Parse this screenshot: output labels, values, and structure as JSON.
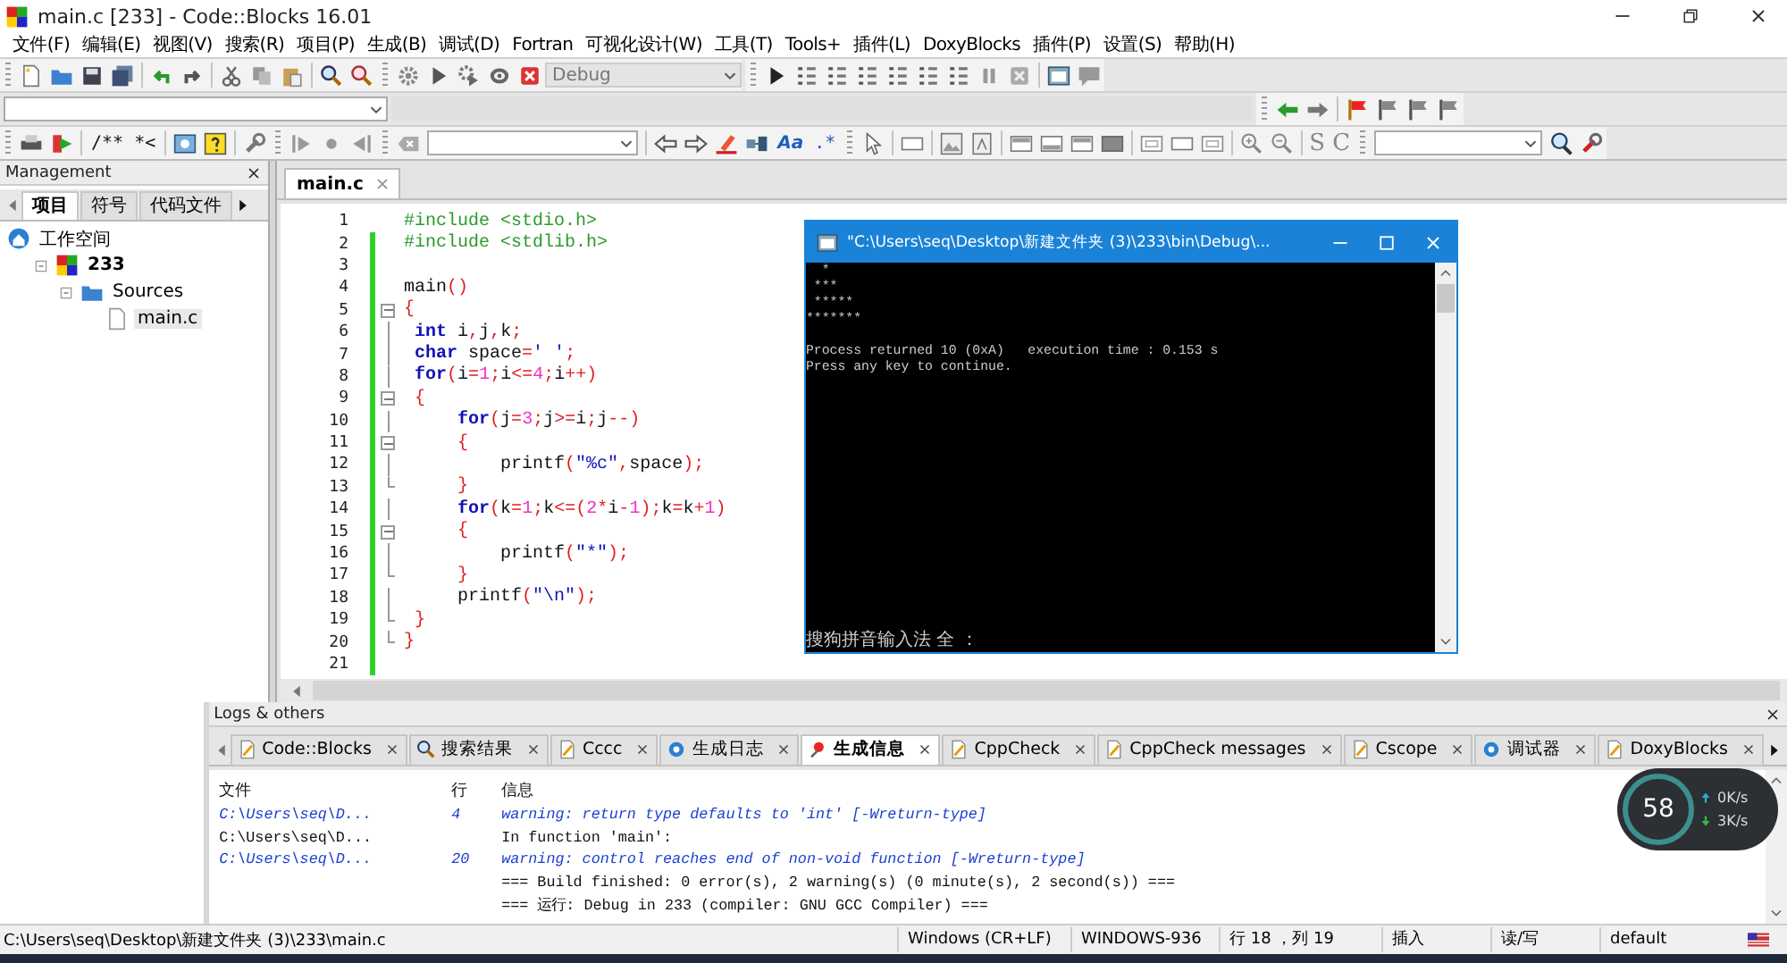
{
  "window": {
    "title": "main.c [233] - Code::Blocks 16.01"
  },
  "menu": [
    "文件(F)",
    "编辑(E)",
    "视图(V)",
    "搜索(R)",
    "项目(P)",
    "生成(B)",
    "调试(D)",
    "Fortran",
    "可视化设计(W)",
    "工具(T)",
    "Tools+",
    "插件(L)",
    "DoxyBlocks",
    "插件(P)",
    "设置(S)",
    "帮助(H)"
  ],
  "toolbar": {
    "build_target": "Debug",
    "doc_comment": "/**",
    "line_comment": "*<",
    "match_case": "Aa",
    "regex": ".*",
    "s_button": "S",
    "c_button": "C"
  },
  "management": {
    "title": "Management",
    "tabs": [
      {
        "label": "项目",
        "selected": true
      },
      {
        "label": "符号",
        "selected": false
      },
      {
        "label": "代码文件",
        "selected": false
      }
    ],
    "tree": [
      {
        "label": "工作空间",
        "kind": "workspace",
        "selected": false,
        "children": [
          {
            "label": "233",
            "kind": "project",
            "selected": false,
            "expanded": true,
            "children": [
              {
                "label": "Sources",
                "kind": "folder",
                "selected": false,
                "expanded": true,
                "children": [
                  {
                    "label": "main.c",
                    "kind": "file",
                    "selected": true
                  }
                ]
              }
            ]
          }
        ]
      }
    ]
  },
  "editor": {
    "tabs": [
      {
        "label": "main.c",
        "selected": true
      }
    ],
    "lines": [
      {
        "number": "1",
        "changed": false,
        "tokens": [
          {
            "kind": "pp",
            "text": "#include <stdio.h>"
          }
        ]
      },
      {
        "number": "2",
        "changed": true,
        "tokens": [
          {
            "kind": "pp",
            "text": "#include <stdlib.h>"
          }
        ]
      },
      {
        "number": "3",
        "changed": true
      },
      {
        "number": "4",
        "changed": true,
        "tokens": [
          {
            "kind": "id",
            "text": "main"
          },
          {
            "kind": "op",
            "text": "()"
          }
        ]
      },
      {
        "number": "5",
        "changed": true,
        "kind": "foldstart",
        "tokens": [
          {
            "kind": "op",
            "text": "{"
          }
        ]
      },
      {
        "number": "6",
        "changed": true,
        "kind": "foldbody",
        "tokens": [
          {
            "kind": "kw",
            "text": " int"
          },
          {
            "kind": "id",
            "text": " i"
          },
          {
            "kind": "op",
            "text": ","
          },
          {
            "kind": "id",
            "text": "j"
          },
          {
            "kind": "op",
            "text": ","
          },
          {
            "kind": "id",
            "text": "k"
          },
          {
            "kind": "op",
            "text": ";"
          }
        ]
      },
      {
        "number": "7",
        "changed": true,
        "kind": "foldbody",
        "tokens": [
          {
            "kind": "kw",
            "text": " char"
          },
          {
            "kind": "id",
            "text": " space"
          },
          {
            "kind": "op",
            "text": "="
          },
          {
            "kind": "str",
            "text": "' '"
          },
          {
            "kind": "op",
            "text": ";"
          }
        ]
      },
      {
        "number": "8",
        "changed": true,
        "kind": "foldbody",
        "tokens": [
          {
            "kind": "kw",
            "text": " for"
          },
          {
            "kind": "op",
            "text": "("
          },
          {
            "kind": "id",
            "text": "i"
          },
          {
            "kind": "op",
            "text": "="
          },
          {
            "kind": "num",
            "text": "1"
          },
          {
            "kind": "op",
            "text": ";"
          },
          {
            "kind": "id",
            "text": "i"
          },
          {
            "kind": "op",
            "text": "<="
          },
          {
            "kind": "num",
            "text": "4"
          },
          {
            "kind": "op",
            "text": ";"
          },
          {
            "kind": "id",
            "text": "i"
          },
          {
            "kind": "op",
            "text": "++)"
          }
        ]
      },
      {
        "number": "9",
        "changed": true,
        "kind": "foldstart",
        "tokens": [
          {
            "kind": "op",
            "text": " {"
          }
        ]
      },
      {
        "number": "10",
        "changed": true,
        "kind": "foldbody",
        "tokens": [
          {
            "kind": "kw",
            "text": "     for"
          },
          {
            "kind": "op",
            "text": "("
          },
          {
            "kind": "id",
            "text": "j"
          },
          {
            "kind": "op",
            "text": "="
          },
          {
            "kind": "num",
            "text": "3"
          },
          {
            "kind": "op",
            "text": ";"
          },
          {
            "kind": "id",
            "text": "j"
          },
          {
            "kind": "op",
            "text": ">="
          },
          {
            "kind": "id",
            "text": "i"
          },
          {
            "kind": "op",
            "text": ";"
          },
          {
            "kind": "id",
            "text": "j"
          },
          {
            "kind": "op",
            "text": "--)"
          }
        ]
      },
      {
        "number": "11",
        "changed": true,
        "kind": "foldstart",
        "tokens": [
          {
            "kind": "op",
            "text": "     {"
          }
        ]
      },
      {
        "number": "12",
        "changed": true,
        "kind": "foldbody",
        "tokens": [
          {
            "kind": "id",
            "text": "         printf"
          },
          {
            "kind": "op",
            "text": "("
          },
          {
            "kind": "str",
            "text": "\"%c\""
          },
          {
            "kind": "op",
            "text": ","
          },
          {
            "kind": "id",
            "text": "space"
          },
          {
            "kind": "op",
            "text": ");"
          }
        ]
      },
      {
        "number": "13",
        "changed": true,
        "kind": "foldend",
        "tokens": [
          {
            "kind": "op",
            "text": "     }"
          }
        ]
      },
      {
        "number": "14",
        "changed": true,
        "kind": "foldbody",
        "tokens": [
          {
            "kind": "kw",
            "text": "     for"
          },
          {
            "kind": "op",
            "text": "("
          },
          {
            "kind": "id",
            "text": "k"
          },
          {
            "kind": "op",
            "text": "="
          },
          {
            "kind": "num",
            "text": "1"
          },
          {
            "kind": "op",
            "text": ";"
          },
          {
            "kind": "id",
            "text": "k"
          },
          {
            "kind": "op",
            "text": "<=("
          },
          {
            "kind": "num",
            "text": "2"
          },
          {
            "kind": "op",
            "text": "*"
          },
          {
            "kind": "id",
            "text": "i"
          },
          {
            "kind": "op",
            "text": "-"
          },
          {
            "kind": "num",
            "text": "1"
          },
          {
            "kind": "op",
            "text": ");"
          },
          {
            "kind": "id",
            "text": "k"
          },
          {
            "kind": "op",
            "text": "="
          },
          {
            "kind": "id",
            "text": "k"
          },
          {
            "kind": "op",
            "text": "+"
          },
          {
            "kind": "num",
            "text": "1"
          },
          {
            "kind": "op",
            "text": ")"
          }
        ]
      },
      {
        "number": "15",
        "changed": true,
        "kind": "foldstart",
        "tokens": [
          {
            "kind": "op",
            "text": "     {"
          }
        ]
      },
      {
        "number": "16",
        "changed": true,
        "kind": "foldbody",
        "tokens": [
          {
            "kind": "id",
            "text": "         printf"
          },
          {
            "kind": "op",
            "text": "("
          },
          {
            "kind": "str",
            "text": "\"*\""
          },
          {
            "kind": "op",
            "text": ");"
          }
        ]
      },
      {
        "number": "17",
        "changed": true,
        "kind": "foldend",
        "tokens": [
          {
            "kind": "op",
            "text": "     }"
          }
        ]
      },
      {
        "number": "18",
        "changed": true,
        "kind": "foldbody",
        "tokens": [
          {
            "kind": "id",
            "text": "     printf"
          },
          {
            "kind": "op",
            "text": "("
          },
          {
            "kind": "str",
            "text": "\"\\n\""
          },
          {
            "kind": "op",
            "text": ");"
          }
        ]
      },
      {
        "number": "19",
        "changed": true,
        "kind": "foldend",
        "tokens": [
          {
            "kind": "op",
            "text": " }"
          }
        ]
      },
      {
        "number": "20",
        "changed": true,
        "kind": "foldend",
        "tokens": [
          {
            "kind": "op",
            "text": "}"
          }
        ]
      },
      {
        "number": "21",
        "changed": true
      }
    ]
  },
  "console": {
    "title": "\"C:\\Users\\seq\\Desktop\\新建文件夹 (3)\\233\\bin\\Debug\\...",
    "output": [
      "  *",
      " ***",
      " *****",
      "*******"
    ],
    "messages": [
      "Process returned 10 (0xA)   execution time : 0.153 s",
      "Press any key to continue."
    ],
    "ime_status": "搜狗拼音输入法 全 ："
  },
  "logs": {
    "title": "Logs & others",
    "tabs": [
      {
        "label": "Code::Blocks",
        "kind": "blocks",
        "selected": false
      },
      {
        "label": "搜索结果",
        "kind": "search",
        "selected": false
      },
      {
        "label": "Cccc",
        "kind": "note",
        "selected": false
      },
      {
        "label": "生成日志",
        "kind": "gear",
        "selected": false
      },
      {
        "label": "生成信息",
        "kind": "pin",
        "selected": true
      },
      {
        "label": "CppCheck",
        "kind": "note",
        "selected": false
      },
      {
        "label": "CppCheck messages",
        "kind": "note",
        "selected": false
      },
      {
        "label": "Cscope",
        "kind": "note",
        "selected": false
      },
      {
        "label": "调试器",
        "kind": "gear",
        "selected": false
      },
      {
        "label": "DoxyBlocks",
        "kind": "note",
        "selected": false
      }
    ],
    "columns": [
      "文件",
      "行",
      "信息"
    ],
    "rows": [
      {
        "kind": "warning",
        "file": "C:\\Users\\seq\\D...",
        "line": "4",
        "message": "warning: return type defaults to 'int' [-Wreturn-type]"
      },
      {
        "kind": "normal",
        "file": "C:\\Users\\seq\\D...",
        "message": "In function 'main':"
      },
      {
        "kind": "warning",
        "file": "C:\\Users\\seq\\D...",
        "line": "20",
        "message": "warning: control reaches end of non-void function [-Wreturn-type]"
      },
      {
        "kind": "normal",
        "message": "=== Build finished: 0 error(s), 2 warning(s) (0 minute(s), 2 second(s)) ==="
      },
      {
        "kind": "normal",
        "message": "=== 运行: Debug in 233 (compiler: GNU GCC Compiler) ==="
      }
    ]
  },
  "status_bar": {
    "path": "C:\\Users\\seq\\Desktop\\新建文件夹 (3)\\233\\main.c",
    "line_endings": "Windows (CR+LF)",
    "encoding": "WINDOWS-936",
    "position": "行 18 ，列 19",
    "mode": "插入",
    "access": "读/写",
    "lexer": "default"
  },
  "net_widget": {
    "percent": "58",
    "upload": "0K/s",
    "download": "3K/s"
  }
}
